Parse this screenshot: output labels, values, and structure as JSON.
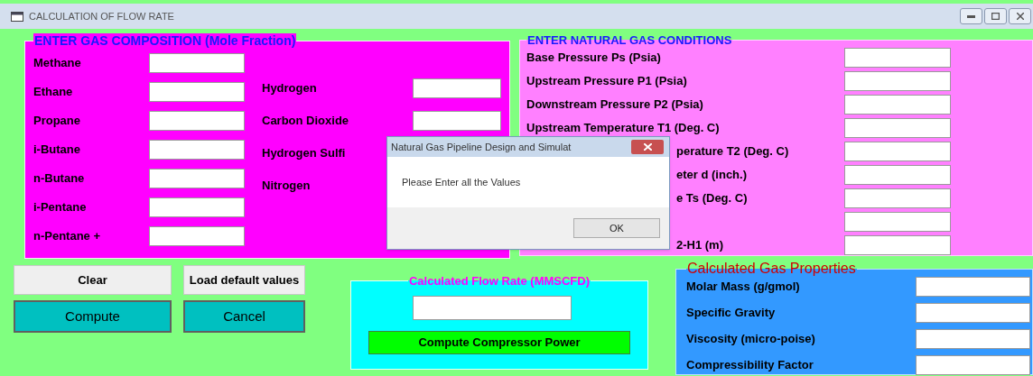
{
  "window": {
    "title": "CALCULATION OF FLOW RATE"
  },
  "composition": {
    "title": "ENTER GAS COMPOSITION (Mole Fraction)",
    "left_fields": [
      "Methane",
      "Ethane",
      "Propane",
      "i-Butane",
      "n-Butane",
      "i-Pentane",
      "n-Pentane +"
    ],
    "right_fields": [
      "Hydrogen",
      "Carbon Dioxide"
    ],
    "covered_labels": [
      "Hydrogen Sulfi",
      "Nitrogen"
    ]
  },
  "conditions": {
    "title": "ENTER NATURAL GAS CONDITIONS",
    "fields": [
      {
        "label": "Base Pressure Ps (Psia)",
        "kind": "full"
      },
      {
        "label": "Upstream Pressure P1 (Psia)",
        "kind": "full"
      },
      {
        "label": "Downstream Pressure P2 (Psia)",
        "kind": "full"
      },
      {
        "label": "Upstream Temperature T1 (Deg. C)",
        "kind": "full"
      },
      {
        "label": "perature T2 (Deg. C)",
        "kind": "partial"
      },
      {
        "label": "eter d (inch.)",
        "kind": "partial"
      },
      {
        "label": "e Ts (Deg. C)",
        "kind": "partial"
      },
      {
        "kind": "blank"
      },
      {
        "label": "2-H1  (m)",
        "kind": "partial"
      }
    ]
  },
  "buttons": [
    {
      "label": "Clear",
      "kind": "plain"
    },
    {
      "label": "Load default values",
      "kind": "plain"
    },
    {
      "label": "Compute",
      "kind": "action"
    },
    {
      "label": "Cancel",
      "kind": "action"
    }
  ],
  "flow_rate": {
    "title": "Calculated Flow Rate  (MMSCFD)",
    "button": "Compute Compressor Power"
  },
  "properties": {
    "title": "Calculated Gas Properties",
    "fields": [
      "Molar Mass (g/gmol)",
      "Specific Gravity",
      "Viscosity (micro-poise)",
      "Compressibility Factor"
    ]
  },
  "dialog": {
    "title": "Natural Gas Pipeline Design and Simulat",
    "message": "Please Enter all the Values",
    "button": "OK"
  }
}
